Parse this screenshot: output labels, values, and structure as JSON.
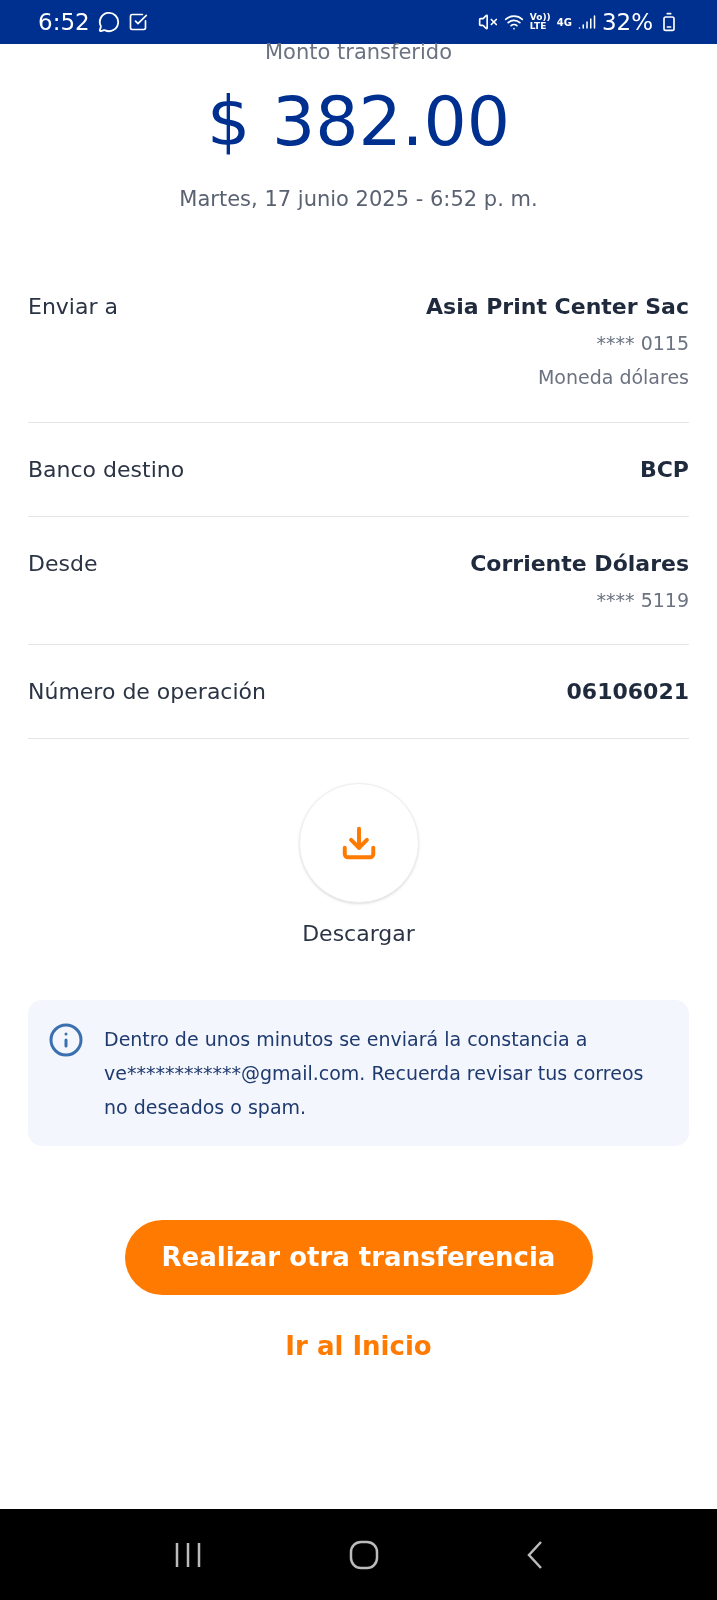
{
  "status_bar": {
    "time": "6:52",
    "volte_top": "Vo))",
    "volte_bottom": "LTE",
    "network": "4G",
    "battery": "32%"
  },
  "amount_label": "Monto transferido",
  "amount": "$ 382.00",
  "date": "Martes, 17 junio 2025 - 6:52 p. m.",
  "details": [
    {
      "label": "Enviar a",
      "values": [
        {
          "text": "Asia Print Center Sac",
          "kind": "main"
        },
        {
          "text": "**** 0115",
          "kind": "sub"
        },
        {
          "text": "Moneda dólares",
          "kind": "sub"
        }
      ]
    },
    {
      "label": "Banco destino",
      "values": [
        {
          "text": "BCP",
          "kind": "main"
        }
      ]
    },
    {
      "label": "Desde",
      "values": [
        {
          "text": "Corriente Dólares",
          "kind": "main"
        },
        {
          "text": "**** 5119",
          "kind": "sub"
        }
      ]
    },
    {
      "label": "Número de operación",
      "values": [
        {
          "text": "06106021",
          "kind": "main"
        }
      ]
    }
  ],
  "download_label": "Descargar",
  "notice": "Dentro de unos minutos se enviará la constancia a ve************@gmail.com. Recuerda revisar tus correos no deseados o spam.",
  "primary_button": "Realizar otra transferencia",
  "secondary_link": "Ir al Inicio"
}
